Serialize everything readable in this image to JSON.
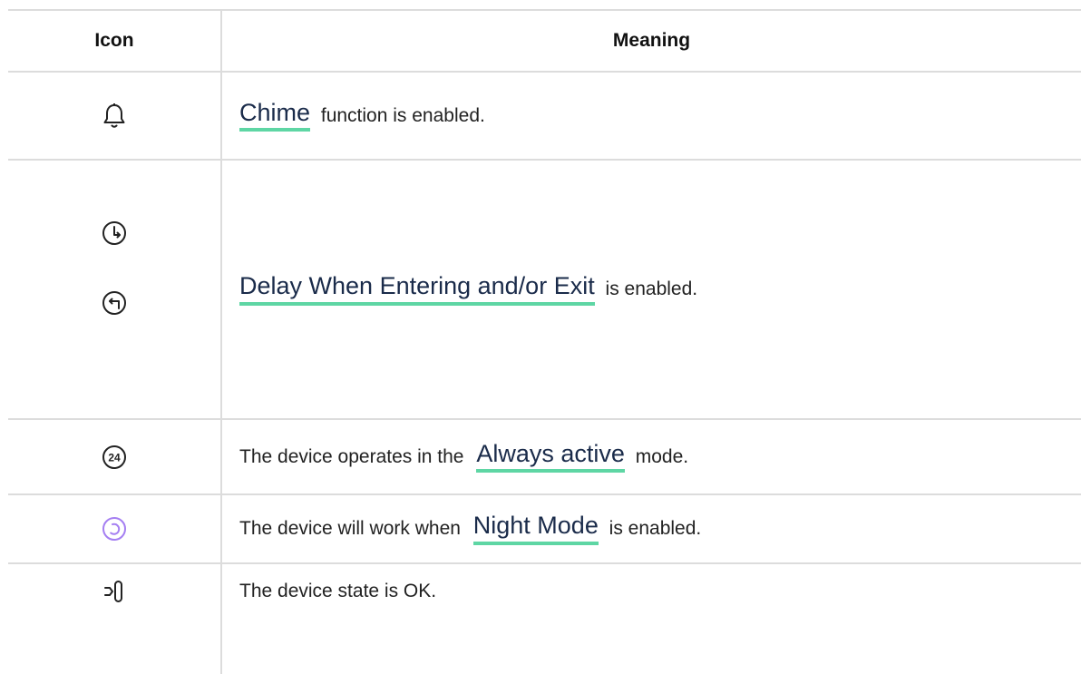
{
  "table": {
    "header": {
      "icon_col": "Icon",
      "meaning_col": "Meaning"
    },
    "rows": [
      {
        "icons": [
          "bell-icon"
        ],
        "link": "Chime",
        "after": " function is enabled."
      },
      {
        "icons": [
          "entry-delay-icon",
          "exit-delay-icon"
        ],
        "link": "Delay When Entering and/or Exit",
        "after": " is enabled."
      },
      {
        "icons": [
          "always-active-24-icon"
        ],
        "icon_text": "24",
        "before": "The device operates in the ",
        "link": "Always active",
        "after": " mode."
      },
      {
        "icons": [
          "night-mode-icon"
        ],
        "before": "The device will work when ",
        "link": "Night Mode",
        "after": " is enabled."
      },
      {
        "icons": [
          "device-state-icon"
        ],
        "text": "The device state is OK."
      }
    ]
  },
  "colors": {
    "link_underline": "#5ed6a4",
    "link_text": "#1a2b4a",
    "night_mode_icon": "#a57ff2",
    "grid": "#dcdcdc"
  }
}
